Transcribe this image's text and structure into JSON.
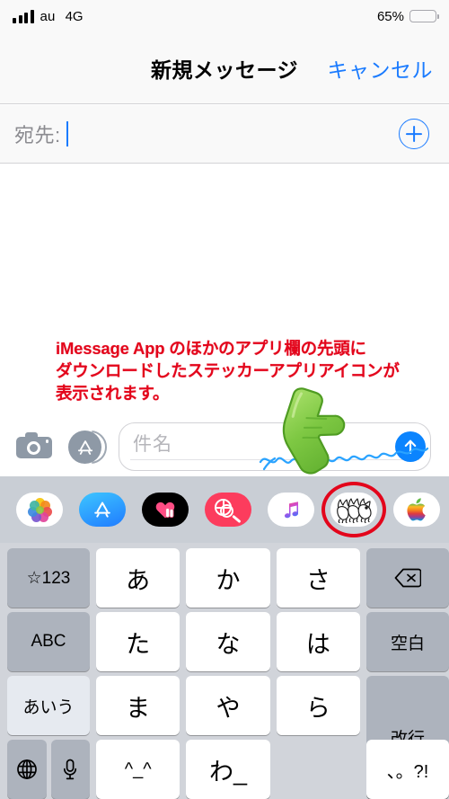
{
  "status_bar": {
    "signal_icon": "signal-bars-icon",
    "carrier": "au",
    "network": "4G",
    "battery_percent": "65%",
    "battery_icon": "battery-icon",
    "battery_color": "#ffcc01",
    "battery_level": 65
  },
  "nav": {
    "title": "新規メッセージ",
    "cancel_label": "キャンセル",
    "accent_color": "#1a7bff"
  },
  "to_field": {
    "label": "宛先:",
    "value": "",
    "add_contact_icon": "plus-circle-icon"
  },
  "annotation": {
    "line1": "iMessage App のほかのアプリ欄の先頭に",
    "line2": "ダウンロードしたステッカーアプリアイコンが",
    "line3": "表示されます。",
    "color": "#e3051b",
    "pointer_icon": "green-pointing-hand-icon",
    "highlight_icon": "red-ellipse-highlight"
  },
  "input_row": {
    "camera_icon": "camera-icon",
    "appstore_icon": "app-store-icon",
    "subject_placeholder": "件名",
    "message_value": "",
    "send_icon": "send-arrow-up-icon",
    "send_color": "#0b84fe"
  },
  "app_drawer": {
    "background_color": "#c9ced5",
    "apps": [
      {
        "name": "photos",
        "icon": "photos-pinwheel-icon",
        "bg": "#ffffff",
        "highlighted": false
      },
      {
        "name": "app-store",
        "icon": "app-store-icon",
        "bg": "#1f7bff",
        "highlighted": false
      },
      {
        "name": "digital-touch",
        "icon": "digital-touch-heart-icon",
        "bg": "#000000",
        "highlighted": false
      },
      {
        "name": "images",
        "icon": "images-globe-search-icon",
        "bg": "#fc3c5d",
        "highlighted": false
      },
      {
        "name": "music",
        "icon": "apple-music-note-icon",
        "bg": "#ffffff",
        "highlighted": false
      },
      {
        "name": "sticker-app",
        "icon": "sticker-doodle-icon",
        "bg": "#ffffff",
        "highlighted": true
      },
      {
        "name": "apple",
        "icon": "apple-rainbow-logo-icon",
        "bg": "#ffffff",
        "highlighted": false
      }
    ]
  },
  "keyboard": {
    "background_color": "#d1d4da",
    "rows": [
      [
        {
          "label": "☆123",
          "type": "fn",
          "style": "gray"
        },
        {
          "label": "あ",
          "type": "char",
          "style": "white"
        },
        {
          "label": "か",
          "type": "char",
          "style": "white"
        },
        {
          "label": "さ",
          "type": "char",
          "style": "white"
        },
        {
          "label": "",
          "type": "delete",
          "style": "gray",
          "icon": "delete-key-icon"
        }
      ],
      [
        {
          "label": "ABC",
          "type": "fn",
          "style": "gray"
        },
        {
          "label": "た",
          "type": "char",
          "style": "white"
        },
        {
          "label": "な",
          "type": "char",
          "style": "white"
        },
        {
          "label": "は",
          "type": "char",
          "style": "white"
        },
        {
          "label": "空白",
          "type": "fn",
          "style": "gray"
        }
      ],
      [
        {
          "label": "あいう",
          "type": "fn",
          "style": "light"
        },
        {
          "label": "ま",
          "type": "char",
          "style": "white"
        },
        {
          "label": "や",
          "type": "char",
          "style": "white"
        },
        {
          "label": "ら",
          "type": "char",
          "style": "white"
        },
        {
          "label": "改行",
          "type": "fn",
          "style": "gray"
        }
      ],
      [
        {
          "label": "",
          "type": "globe",
          "style": "gray",
          "icon": "globe-key-icon"
        },
        {
          "label": "",
          "type": "mic",
          "style": "gray",
          "icon": "microphone-key-icon"
        },
        {
          "label": "^_^",
          "type": "char",
          "style": "white"
        },
        {
          "label": "わ_",
          "type": "char",
          "style": "white"
        },
        {
          "label": "、。?!",
          "type": "char",
          "style": "white"
        }
      ]
    ]
  }
}
